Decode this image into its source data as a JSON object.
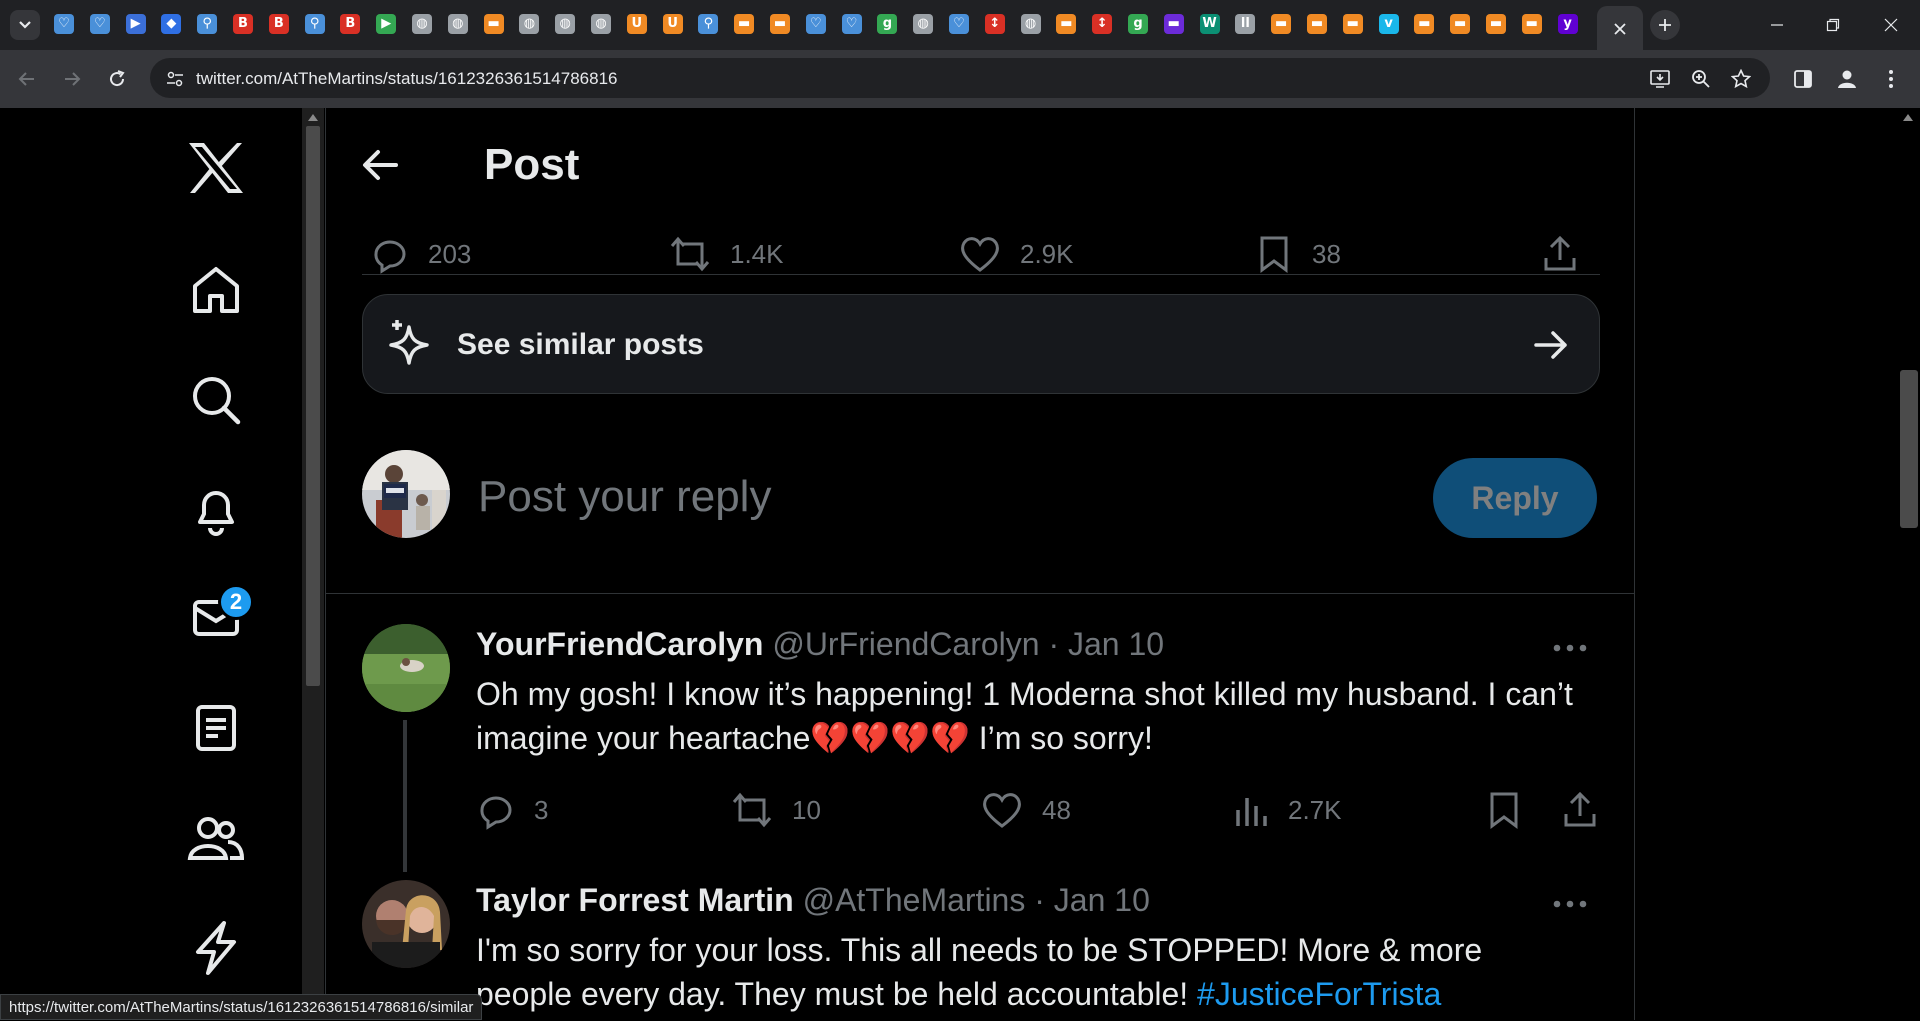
{
  "browser": {
    "url": "twitter.com/AtTheMartins/status/1612326361514786816",
    "favicons": [
      {
        "color": "#4a90d9",
        "glyph": "♡"
      },
      {
        "color": "#4a90d9",
        "glyph": "♡"
      },
      {
        "color": "#3b6fd8",
        "glyph": "▶"
      },
      {
        "color": "#2f6fe4",
        "glyph": "◆"
      },
      {
        "color": "#4a90d9",
        "glyph": "⚲"
      },
      {
        "color": "#d93025",
        "glyph": "B"
      },
      {
        "color": "#d93025",
        "glyph": "B"
      },
      {
        "color": "#4a90d9",
        "glyph": "⚲"
      },
      {
        "color": "#d93025",
        "glyph": "B"
      },
      {
        "color": "#34a853",
        "glyph": "▶"
      },
      {
        "color": "#9aa0a6",
        "glyph": "◍"
      },
      {
        "color": "#9aa0a6",
        "glyph": "◍"
      },
      {
        "color": "#f08a24",
        "glyph": "▬"
      },
      {
        "color": "#9aa0a6",
        "glyph": "◍"
      },
      {
        "color": "#9aa0a6",
        "glyph": "◍"
      },
      {
        "color": "#9aa0a6",
        "glyph": "◍"
      },
      {
        "color": "#f08a24",
        "glyph": "U"
      },
      {
        "color": "#f08a24",
        "glyph": "U"
      },
      {
        "color": "#4a90d9",
        "glyph": "⚲"
      },
      {
        "color": "#f08a24",
        "glyph": "▬"
      },
      {
        "color": "#f08a24",
        "glyph": "▬"
      },
      {
        "color": "#4a90d9",
        "glyph": "♡"
      },
      {
        "color": "#4a90d9",
        "glyph": "♡"
      },
      {
        "color": "#34a853",
        "glyph": "g"
      },
      {
        "color": "#9aa0a6",
        "glyph": "◍"
      },
      {
        "color": "#4a90d9",
        "glyph": "♡"
      },
      {
        "color": "#d93025",
        "glyph": "↕"
      },
      {
        "color": "#9aa0a6",
        "glyph": "◍"
      },
      {
        "color": "#f08a24",
        "glyph": "▬"
      },
      {
        "color": "#d93025",
        "glyph": "↕"
      },
      {
        "color": "#34a853",
        "glyph": "g"
      },
      {
        "color": "#6c2bd9",
        "glyph": "▬"
      },
      {
        "color": "#0b8f73",
        "glyph": "W"
      },
      {
        "color": "#9aa0a6",
        "glyph": "ll"
      },
      {
        "color": "#f08a24",
        "glyph": "▬"
      },
      {
        "color": "#f08a24",
        "glyph": "▬"
      },
      {
        "color": "#f08a24",
        "glyph": "▬"
      },
      {
        "color": "#1ab7ea",
        "glyph": "v"
      },
      {
        "color": "#f08a24",
        "glyph": "▬"
      },
      {
        "color": "#f08a24",
        "glyph": "▬"
      },
      {
        "color": "#f08a24",
        "glyph": "▬"
      },
      {
        "color": "#f08a24",
        "glyph": "▬"
      },
      {
        "color": "#6001d2",
        "glyph": "y"
      }
    ],
    "status_url": "https://twitter.com/AtTheMartins/status/1612326361514786816/similar"
  },
  "sidebar": {
    "messages_badge": "2"
  },
  "header": {
    "title": "Post"
  },
  "post_stats": {
    "replies": "203",
    "reposts": "1.4K",
    "likes": "2.9K",
    "bookmarks": "38"
  },
  "similar": {
    "label": "See similar posts"
  },
  "composer": {
    "placeholder": "Post your reply",
    "reply_label": "Reply"
  },
  "replies": [
    {
      "name": "YourFriendCarolyn",
      "handle": "@UrFriendCarolyn",
      "date": "· Jan 10",
      "text_a": "Oh my gosh! I know it’s happening! 1 Moderna shot killed my husband. I can’t imagine your heartache",
      "hearts": "💔💔💔💔",
      "text_b": " I’m so sorry!",
      "replies": "3",
      "reposts": "10",
      "likes": "48",
      "views": "2.7K"
    },
    {
      "name": "Taylor Forrest Martin",
      "handle": "@AtTheMartins",
      "date": "· Jan 10",
      "text_a": "I'm so sorry for your loss. This all needs to be STOPPED! More & more people every day. They must be held accountable! ",
      "hashtag": "#JusticeForTrista"
    }
  ],
  "colors": {
    "accent": "#1d9bf0",
    "muted": "#71767b",
    "border": "#2f3336",
    "reply_button": "#0f4e78"
  }
}
